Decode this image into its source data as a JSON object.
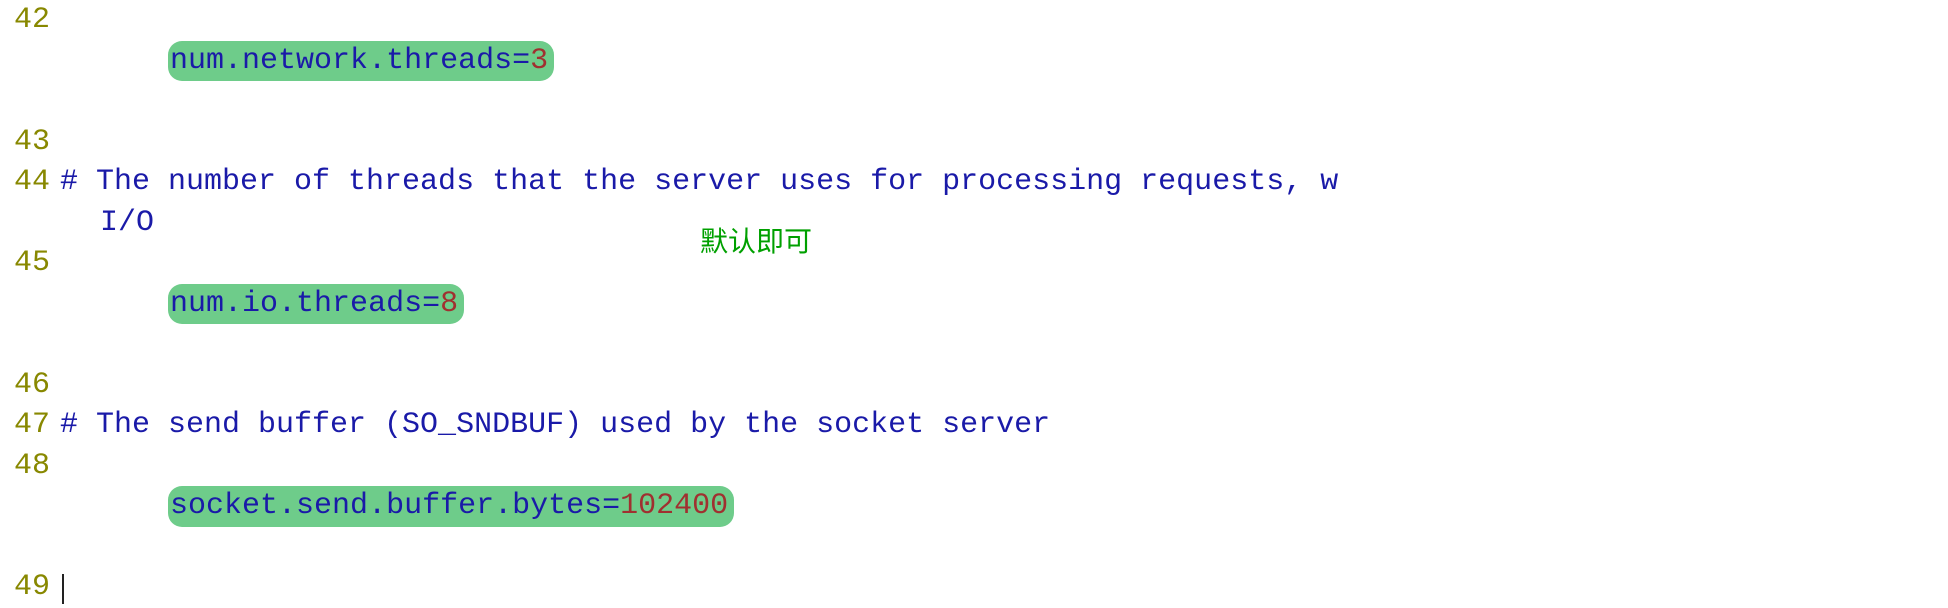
{
  "lines": {
    "l42": {
      "num": "42",
      "key": "num.network.threads",
      "eq": "=",
      "val": "3"
    },
    "l43": {
      "num": "43"
    },
    "l44": {
      "num": "44",
      "comment": "# The number of threads that the server uses for processing requests, w",
      "wrap": "I/O"
    },
    "l45": {
      "num": "45",
      "key": "num.io.threads",
      "eq": "=",
      "val": "8"
    },
    "l46": {
      "num": "46"
    },
    "l47": {
      "num": "47",
      "comment": "# The send buffer (SO_SNDBUF) used by the socket server"
    },
    "l48": {
      "num": "48",
      "key": "socket.send.buffer.bytes",
      "eq": "=",
      "val": "102400"
    },
    "l49": {
      "num": "49"
    }
  },
  "annotation": {
    "text": "默认即可"
  }
}
